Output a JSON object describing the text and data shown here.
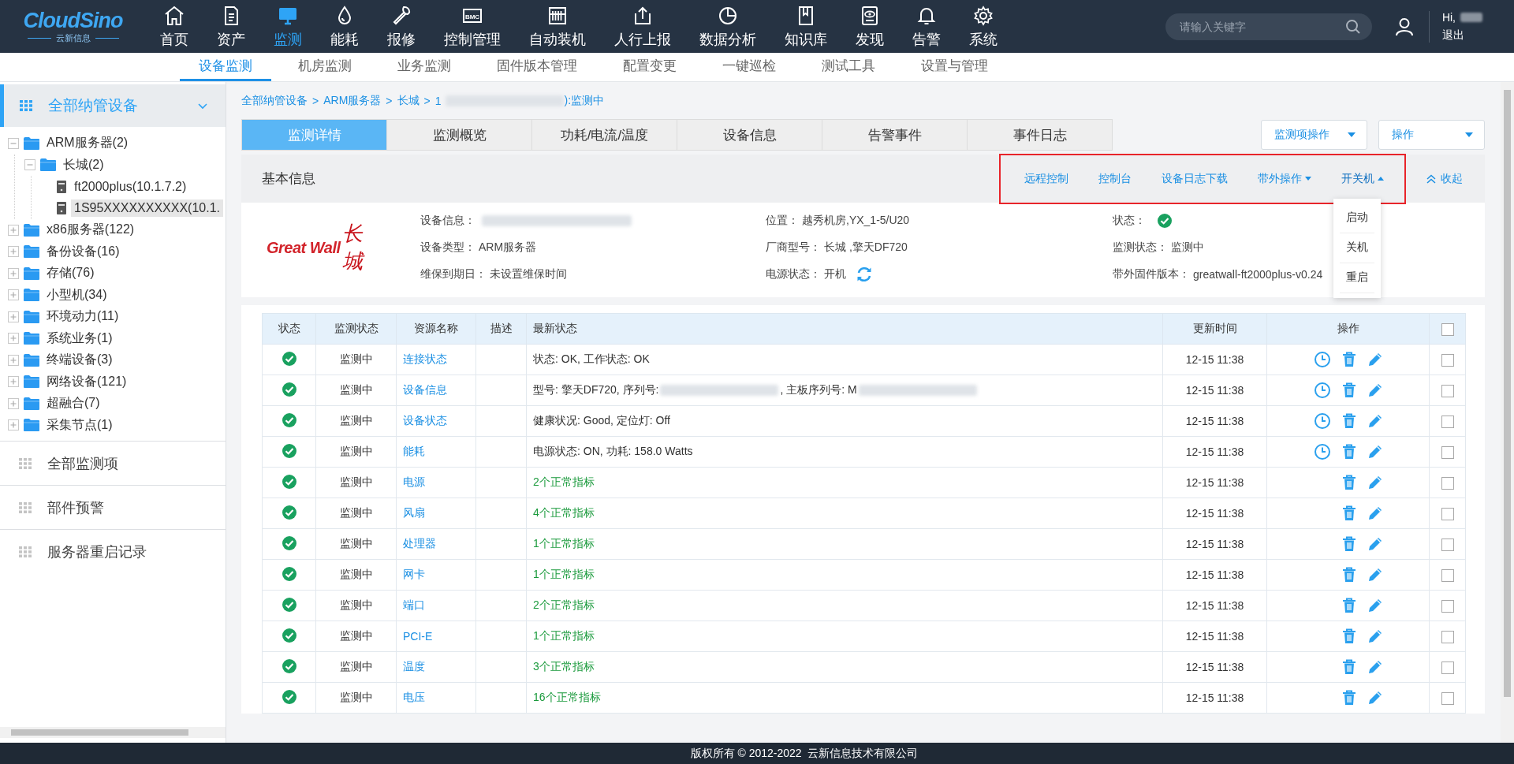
{
  "logo": {
    "name": "CloudSino",
    "tagline": "云新信息"
  },
  "nav": [
    {
      "label": "首页",
      "selected": false
    },
    {
      "label": "资产",
      "selected": false
    },
    {
      "label": "监测",
      "selected": true
    },
    {
      "label": "能耗",
      "selected": false
    },
    {
      "label": "报修",
      "selected": false
    },
    {
      "label": "控制管理",
      "selected": false,
      "icon_text": "BMC"
    },
    {
      "label": "自动装机",
      "selected": false
    },
    {
      "label": "人行上报",
      "selected": false
    },
    {
      "label": "数据分析",
      "selected": false
    },
    {
      "label": "知识库",
      "selected": false
    },
    {
      "label": "发现",
      "selected": false
    },
    {
      "label": "告警",
      "selected": false
    },
    {
      "label": "系统",
      "selected": false
    }
  ],
  "search": {
    "placeholder": "请输入关键字"
  },
  "user": {
    "greeting": "Hi,",
    "logout": "退出"
  },
  "subnav": [
    {
      "label": "设备监测",
      "selected": true
    },
    {
      "label": "机房监测",
      "selected": false
    },
    {
      "label": "业务监测",
      "selected": false
    },
    {
      "label": "固件版本管理",
      "selected": false
    },
    {
      "label": "配置变更",
      "selected": false
    },
    {
      "label": "一键巡检",
      "selected": false
    },
    {
      "label": "测试工具",
      "selected": false
    },
    {
      "label": "设置与管理",
      "selected": false
    }
  ],
  "sidebar": {
    "header": {
      "label": "全部纳管设备",
      "expanded": true
    },
    "tree": [
      {
        "label": "ARM服务器(2)",
        "kind": "folder",
        "expanded": true,
        "selected": false,
        "children": [
          {
            "label": "长城(2)",
            "kind": "folder",
            "expanded": true,
            "selected": false,
            "children": [
              {
                "label": "ft2000plus(10.1.7.2)",
                "kind": "device",
                "selected": false
              },
              {
                "label": "1S95XXXXXXXXXX(10.1.",
                "kind": "device",
                "selected": true
              }
            ]
          }
        ]
      },
      {
        "label": "x86服务器(122)",
        "kind": "folder",
        "expanded": false,
        "selected": false
      },
      {
        "label": "备份设备(16)",
        "kind": "folder",
        "expanded": false,
        "selected": false
      },
      {
        "label": "存储(76)",
        "kind": "folder",
        "expanded": false,
        "selected": false
      },
      {
        "label": "小型机(34)",
        "kind": "folder",
        "expanded": false,
        "selected": false
      },
      {
        "label": "环境动力(11)",
        "kind": "folder",
        "expanded": false,
        "selected": false
      },
      {
        "label": "系统业务(1)",
        "kind": "folder",
        "expanded": false,
        "selected": false
      },
      {
        "label": "终端设备(3)",
        "kind": "folder",
        "expanded": false,
        "selected": false
      },
      {
        "label": "网络设备(121)",
        "kind": "folder",
        "expanded": false,
        "selected": false
      },
      {
        "label": "超融合(7)",
        "kind": "folder",
        "expanded": false,
        "selected": false
      },
      {
        "label": "采集节点(1)",
        "kind": "folder",
        "expanded": false,
        "selected": false
      }
    ],
    "sections": [
      "全部监测项",
      "部件预警",
      "服务器重启记录"
    ]
  },
  "breadcrumb": {
    "items": [
      "全部纳管设备",
      "ARM服务器",
      "长城"
    ],
    "separator": ">",
    "current_prefix": "1",
    "current_suffix": "):监测中"
  },
  "tabs": [
    {
      "label": "监测详情",
      "selected": true
    },
    {
      "label": "监测概览",
      "selected": false
    },
    {
      "label": "功耗/电流/温度",
      "selected": false
    },
    {
      "label": "设备信息",
      "selected": false
    },
    {
      "label": "告警事件",
      "selected": false
    },
    {
      "label": "事件日志",
      "selected": false
    }
  ],
  "toolbar_buttons": [
    "监测项操作",
    "操作"
  ],
  "basic_info": {
    "title": "基本信息",
    "highlighted": true,
    "actions": [
      {
        "label": "远程控制",
        "kind": "link"
      },
      {
        "label": "控制台",
        "kind": "link"
      },
      {
        "label": "设备日志下载",
        "kind": "link"
      },
      {
        "label": "带外操作",
        "kind": "dropdown",
        "open": false
      },
      {
        "label": "开关机",
        "kind": "dropdown",
        "open": true,
        "menu": [
          "启动",
          "关机",
          "重启"
        ]
      },
      {
        "label": "收起",
        "kind": "collapse"
      }
    ],
    "vendor_logo": {
      "latin": "Great Wall",
      "chinese": "长城"
    },
    "fields": [
      {
        "label": "设备信息：",
        "kind": "redacted"
      },
      {
        "label": "位置：",
        "kind": "text",
        "value": "越秀机房,YX_1-5/U20"
      },
      {
        "label": "状态：",
        "kind": "status_ok"
      },
      {
        "label": "设备类型：",
        "kind": "text",
        "value": "ARM服务器"
      },
      {
        "label": "厂商型号：",
        "kind": "text",
        "value": "长城 ,擎天DF720"
      },
      {
        "label": "监测状态：",
        "kind": "text",
        "value": "监测中"
      },
      {
        "label": "维保到期日：",
        "kind": "text",
        "value": "未设置维保时间"
      },
      {
        "label": "电源状态：",
        "kind": "power",
        "value": "开机"
      },
      {
        "label": "带外固件版本：",
        "kind": "text",
        "value": "greatwall-ft2000plus-v0.24"
      }
    ]
  },
  "table": {
    "columns": [
      "状态",
      "监测状态",
      "资源名称",
      "描述",
      "最新状态",
      "更新时间",
      "操作"
    ],
    "select_all": {
      "checked": false
    },
    "rows": [
      {
        "healthy": true,
        "monitor": "监测中",
        "name": "连接状态",
        "kind": "detail",
        "latest": "状态: OK, 工作状态: OK",
        "time": "12-15 11:38",
        "has_history": true,
        "checked": false
      },
      {
        "healthy": true,
        "monitor": "监测中",
        "name": "设备信息",
        "kind": "detail",
        "latest_segments": [
          {
            "kind": "text",
            "text": "型号: 擎天DF720, 序列号:"
          },
          {
            "kind": "redacted"
          },
          {
            "kind": "text",
            "text": ", 主板序列号: M"
          },
          {
            "kind": "redacted"
          }
        ],
        "time": "12-15 11:38",
        "has_history": true,
        "checked": false
      },
      {
        "healthy": true,
        "monitor": "监测中",
        "name": "设备状态",
        "kind": "detail",
        "latest": "健康状况: Good, 定位灯: Off",
        "time": "12-15 11:38",
        "has_history": true,
        "checked": false
      },
      {
        "healthy": true,
        "monitor": "监测中",
        "name": "能耗",
        "kind": "detail",
        "latest": "电源状态: ON, 功耗: 158.0 Watts",
        "time": "12-15 11:38",
        "has_history": true,
        "checked": false
      },
      {
        "healthy": true,
        "monitor": "监测中",
        "name": "电源",
        "kind": "summary",
        "latest": "2个正常指标",
        "time": "12-15 11:38",
        "has_history": false,
        "checked": false
      },
      {
        "healthy": true,
        "monitor": "监测中",
        "name": "风扇",
        "kind": "summary",
        "latest": "4个正常指标",
        "time": "12-15 11:38",
        "has_history": false,
        "checked": false
      },
      {
        "healthy": true,
        "monitor": "监测中",
        "name": "处理器",
        "kind": "summary",
        "latest": "1个正常指标",
        "time": "12-15 11:38",
        "has_history": false,
        "checked": false
      },
      {
        "healthy": true,
        "monitor": "监测中",
        "name": "网卡",
        "kind": "summary",
        "latest": "1个正常指标",
        "time": "12-15 11:38",
        "has_history": false,
        "checked": false
      },
      {
        "healthy": true,
        "monitor": "监测中",
        "name": "端口",
        "kind": "summary",
        "latest": "2个正常指标",
        "time": "12-15 11:38",
        "has_history": false,
        "checked": false
      },
      {
        "healthy": true,
        "monitor": "监测中",
        "name": "PCI-E",
        "kind": "summary",
        "latest": "1个正常指标",
        "time": "12-15 11:38",
        "has_history": false,
        "checked": false
      },
      {
        "healthy": true,
        "monitor": "监测中",
        "name": "温度",
        "kind": "summary",
        "latest": "3个正常指标",
        "time": "12-15 11:38",
        "has_history": false,
        "checked": false
      },
      {
        "healthy": true,
        "monitor": "监测中",
        "name": "电压",
        "kind": "summary",
        "latest": "16个正常指标",
        "time": "12-15 11:38",
        "has_history": false,
        "checked": false
      }
    ]
  },
  "footer": {
    "copyright": "版权所有 © 2012-2022  云新信息技术有限公司"
  }
}
